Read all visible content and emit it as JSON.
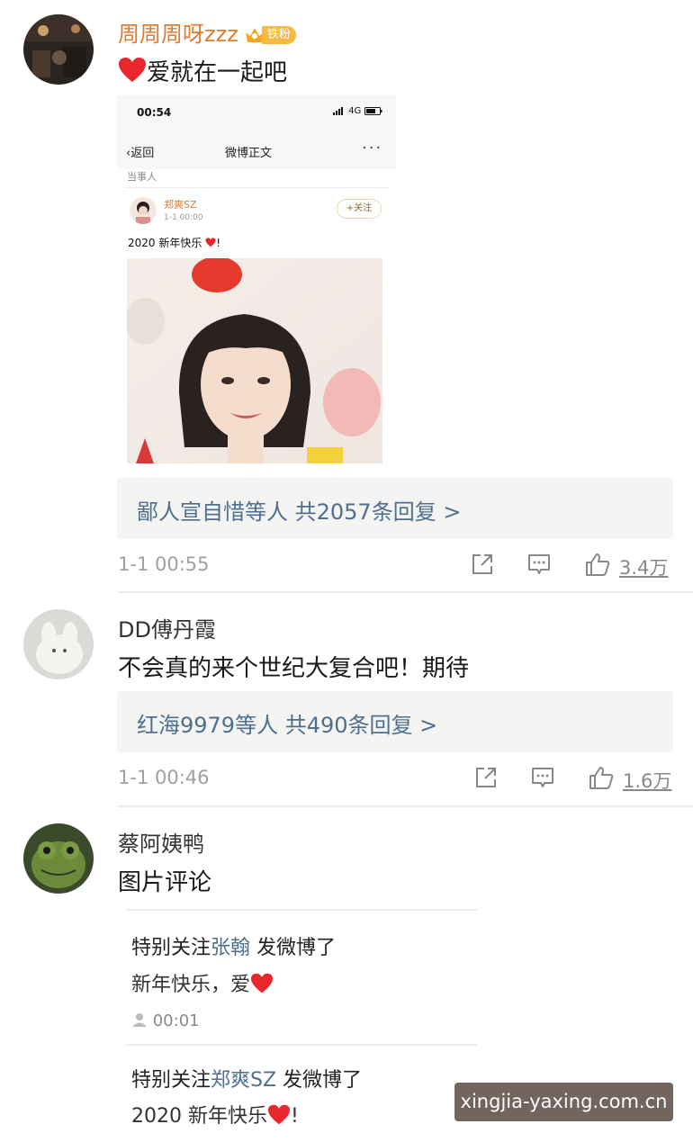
{
  "comments": [
    {
      "username": "周周周呀zzz",
      "badge": "铁粉",
      "text": "爱就在一起吧",
      "embed": {
        "status_time": "00:54",
        "status_signal": "4G",
        "nav_back": "返回",
        "nav_title": "微博正文",
        "nav_more": "···",
        "tag": "当事人",
        "post_user": "郑爽SZ",
        "post_date": "1-1 00:00",
        "follow_label": "+关注",
        "post_text": "2020 新年快乐",
        "post_text_suffix": "!"
      },
      "replies": "鄙人宣自惜等人  共2057条回复 >",
      "time": "1-1 00:55",
      "likes": "3.4万"
    },
    {
      "username": "DD傅丹霞",
      "text": "不会真的来个世纪大复合吧！期待",
      "replies": "红海9979等人  共490条回复 >",
      "time": "1-1 00:46",
      "likes": "1.6万"
    },
    {
      "username": "蔡阿姨鸭",
      "text": "图片评论",
      "quotes": [
        {
          "prefix": "特别关注",
          "name": "张翰",
          "suffix": " 发微博了",
          "body": "新年快乐，爱",
          "meta": "00:01"
        },
        {
          "prefix": "特别关注",
          "name": "郑爽SZ",
          "suffix": " 发微博了",
          "body": "2020 新年快乐",
          "body_suffix": "!"
        }
      ]
    }
  ],
  "watermark": "xingjia-yaxing.com.cn",
  "icons": [
    "share-icon",
    "comment-icon",
    "like-icon",
    "heart-icon",
    "crown-icon"
  ],
  "colors": {
    "vip_name": "#e07b2e",
    "link": "#4f6f8f",
    "heart": "#e8262b",
    "reply_bg": "#f4f4f2"
  }
}
